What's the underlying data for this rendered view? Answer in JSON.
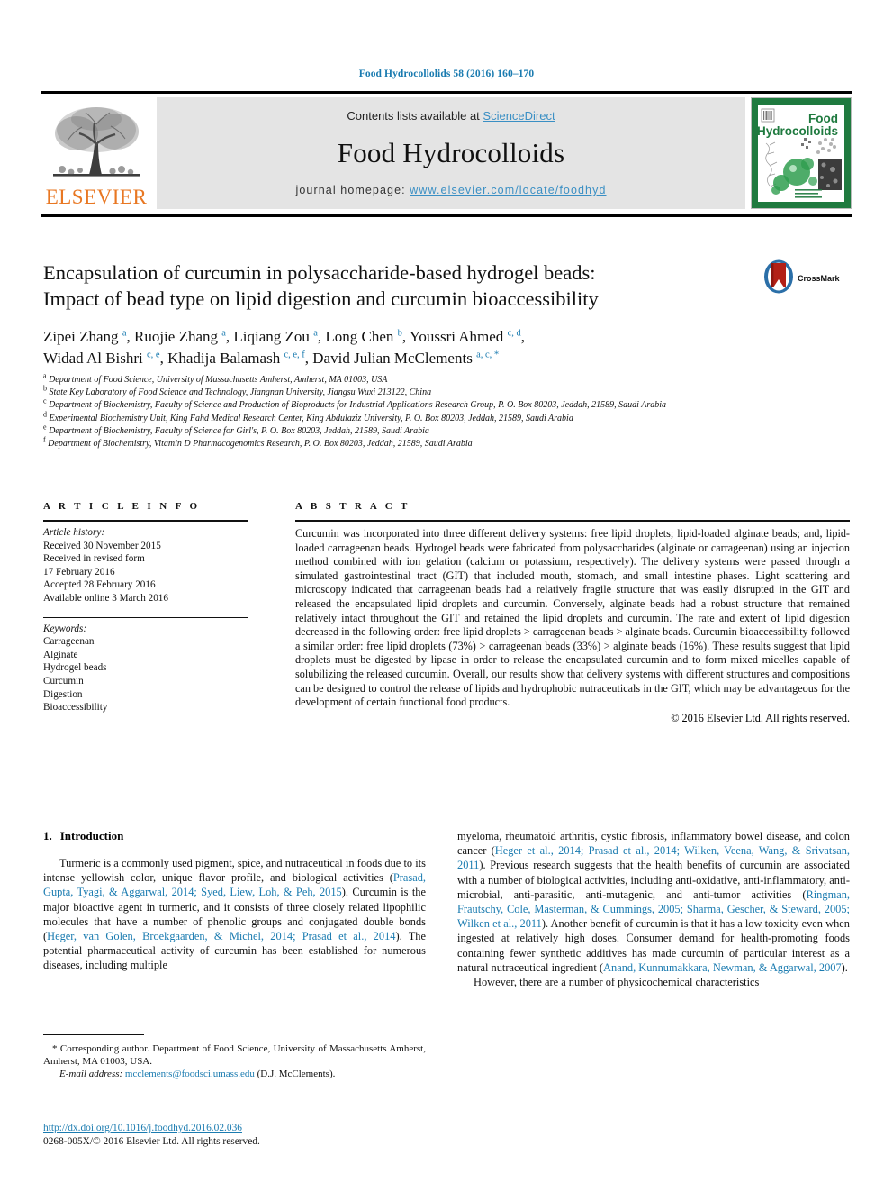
{
  "running_head": "Food Hydrocollolids 58 (2016) 160–170",
  "masthead": {
    "publisher_name": "ELSEVIER",
    "publisher_logo_icon": "elsevier-tree-logo",
    "contents_prefix": "Contents lists available at ",
    "contents_link": "ScienceDirect",
    "journal_name": "Food Hydrocolloids",
    "homepage_prefix": "journal homepage: ",
    "homepage_url": "www.elsevier.com/locate/foodhyd",
    "cover_title_line1": "Food",
    "cover_title_line2": "Hydrocolloids"
  },
  "article": {
    "title_line1": "Encapsulation of curcumin in polysaccharide-based hydrogel beads:",
    "title_line2": "Impact of bead type on lipid digestion and curcumin bioaccessibility",
    "crossmark_label": "CrossMark",
    "authors_line1": "Zipei Zhang <sup>a</sup>, Ruojie Zhang <sup>a</sup>, Liqiang Zou <sup>a</sup>, Long Chen <sup>b</sup>, Youssri Ahmed <sup>c, d</sup>,",
    "authors_line2": "Widad Al Bishri <sup>c, e</sup>, Khadija Balamash <sup>c, e, f</sup>, David Julian McClements <sup>a, c, *</sup>",
    "affiliations": [
      "<sup>a</sup> Department of Food Science, University of Massachusetts Amherst, Amherst, MA 01003, USA",
      "<sup>b</sup> State Key Laboratory of Food Science and Technology, Jiangnan University, Jiangsu Wuxi 213122, China",
      "<sup>c</sup> Department of Biochemistry, Faculty of Science and Production of Bioproducts for Industrial Applications Research Group, P. O. Box 80203, Jeddah, 21589, Saudi Arabia",
      "<sup>d</sup> Experimental Biochemistry Unit, King Fahd Medical Research Center, King Abdulaziz University, P. O. Box 80203, Jeddah, 21589, Saudi Arabia",
      "<sup>e</sup> Department of Biochemistry, Faculty of Science for Girl's, P. O. Box 80203, Jeddah, 21589, Saudi Arabia",
      "<sup>f</sup> Department of Biochemistry, Vitamin D Pharmacogenomics Research, P. O. Box 80203, Jeddah, 21589, Saudi Arabia"
    ]
  },
  "article_info": {
    "heading": "A R T I C L E   I N F O",
    "history_label": "Article history:",
    "history": [
      "Received 30 November 2015",
      "Received in revised form",
      "17 February 2016",
      "Accepted 28 February 2016",
      "Available online 3 March 2016"
    ],
    "keywords_label": "Keywords:",
    "keywords": [
      "Carrageenan",
      "Alginate",
      "Hydrogel beads",
      "Curcumin",
      "Digestion",
      "Bioaccessibility"
    ]
  },
  "abstract": {
    "heading": "A B S T R A C T",
    "text": "Curcumin was incorporated into three different delivery systems: free lipid droplets; lipid-loaded alginate beads; and, lipid-loaded carrageenan beads. Hydrogel beads were fabricated from polysaccharides (alginate or carrageenan) using an injection method combined with ion gelation (calcium or potassium, respectively). The delivery systems were passed through a simulated gastrointestinal tract (GIT) that included mouth, stomach, and small intestine phases. Light scattering and microscopy indicated that carrageenan beads had a relatively fragile structure that was easily disrupted in the GIT and released the encapsulated lipid droplets and curcumin. Conversely, alginate beads had a robust structure that remained relatively intact throughout the GIT and retained the lipid droplets and curcumin. The rate and extent of lipid digestion decreased in the following order: free lipid droplets > carrageenan beads > alginate beads. Curcumin bioaccessibility followed a similar order: free lipid droplets (73%) > carrageenan beads (33%) > alginate beads (16%). These results suggest that lipid droplets must be digested by lipase in order to release the encapsulated curcumin and to form mixed micelles capable of solubilizing the released curcumin. Overall, our results show that delivery systems with different structures and compositions can be designed to control the release of lipids and hydrophobic nutraceuticals in the GIT, which may be advantageous for the development of certain functional food products.",
    "copyright": "© 2016 Elsevier Ltd. All rights reserved."
  },
  "intro": {
    "number": "1.",
    "heading": "Introduction",
    "left_para": "Turmeric is a commonly used pigment, spice, and nutraceutical in foods due to its intense yellowish color, unique flavor profile, and biological activities (<span class=\"cite\">Prasad, Gupta, Tyagi, &amp; Aggarwal, 2014; Syed, Liew, Loh, &amp; Peh, 2015</span>). Curcumin is the major bioactive agent in turmeric, and it consists of three closely related lipophilic molecules that have a number of phenolic groups and conjugated double bonds (<span class=\"cite\">Heger, van Golen, Broekgaarden, &amp; Michel, 2014; Prasad et al., 2014</span>). The potential pharmaceutical activity of curcumin has been established for numerous diseases, including multiple",
    "right_para_1": "myeloma, rheumatoid arthritis, cystic fibrosis, inflammatory bowel disease, and colon cancer (<span class=\"cite\">Heger et al., 2014; Prasad et al., 2014; Wilken, Veena, Wang, &amp; Srivatsan, 2011</span>). Previous research suggests that the health benefits of curcumin are associated with a number of biological activities, including anti-oxidative, anti-inflammatory, anti-microbial, anti-parasitic, anti-mutagenic, and anti-tumor activities (<span class=\"cite\">Ringman, Frautschy, Cole, Masterman, &amp; Cummings, 2005; Sharma, Gescher, &amp; Steward, 2005; Wilken et al., 2011</span>). Another benefit of curcumin is that it has a low toxicity even when ingested at relatively high doses. Consumer demand for health-promoting foods containing fewer synthetic additives has made curcumin of particular interest as a natural nutraceutical ingredient (<span class=\"cite\">Anand, Kunnumakkara, Newman, &amp; Aggarwal, 2007</span>).",
    "right_para_2": "However, there are a number of physicochemical characteristics"
  },
  "footnote": {
    "corresponding": "* Corresponding author. Department of Food Science, University of Massachusetts Amherst, Amherst, MA 01003, USA.",
    "email_label": "E-mail address:",
    "email": "mcclements@foodsci.umass.edu",
    "email_suffix": "(D.J. McClements)."
  },
  "footer": {
    "doi": "http://dx.doi.org/10.1016/j.foodhyd.2016.02.036",
    "issn": "0268-005X/© 2016 Elsevier Ltd. All rights reserved."
  },
  "colors": {
    "link_blue": "#1a7bb0",
    "elsevier_orange": "#e87722",
    "banner_gray": "#e4e4e4",
    "cover_green": "#1f7a3f"
  }
}
